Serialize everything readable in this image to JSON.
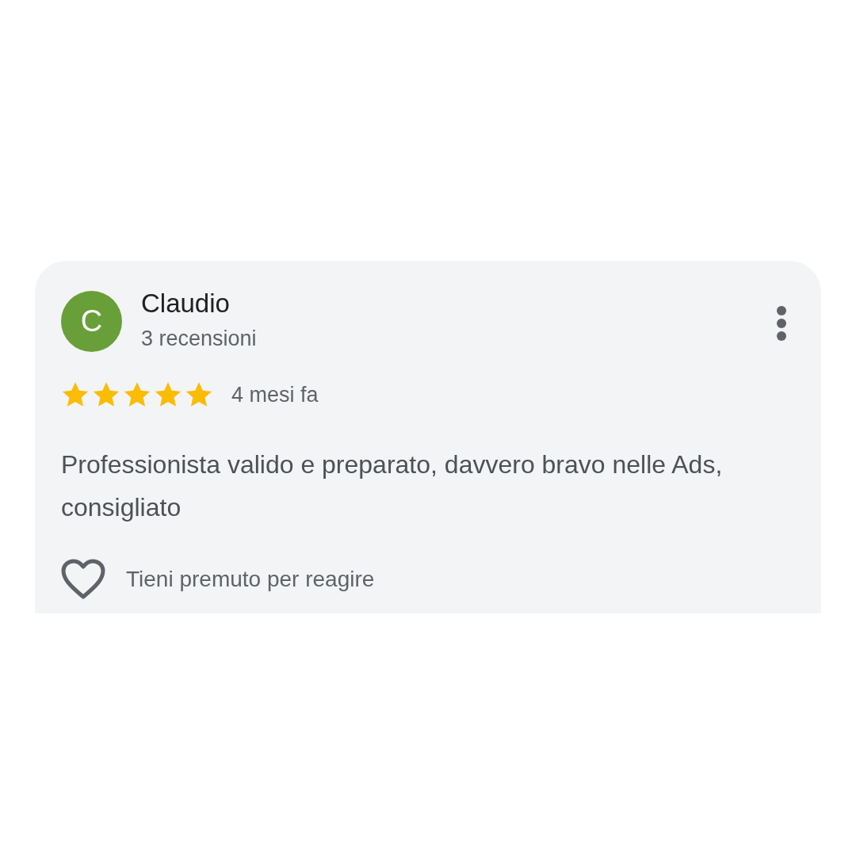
{
  "review": {
    "avatar_letter": "C",
    "author": "Claudio",
    "review_count": "3 recensioni",
    "stars": 5,
    "time": "4 mesi fa",
    "text": "Professionista valido e preparato, davvero bravo nelle Ads, consigliato",
    "liked": false,
    "reaction_hint": "Tieni premuto per reagire"
  }
}
